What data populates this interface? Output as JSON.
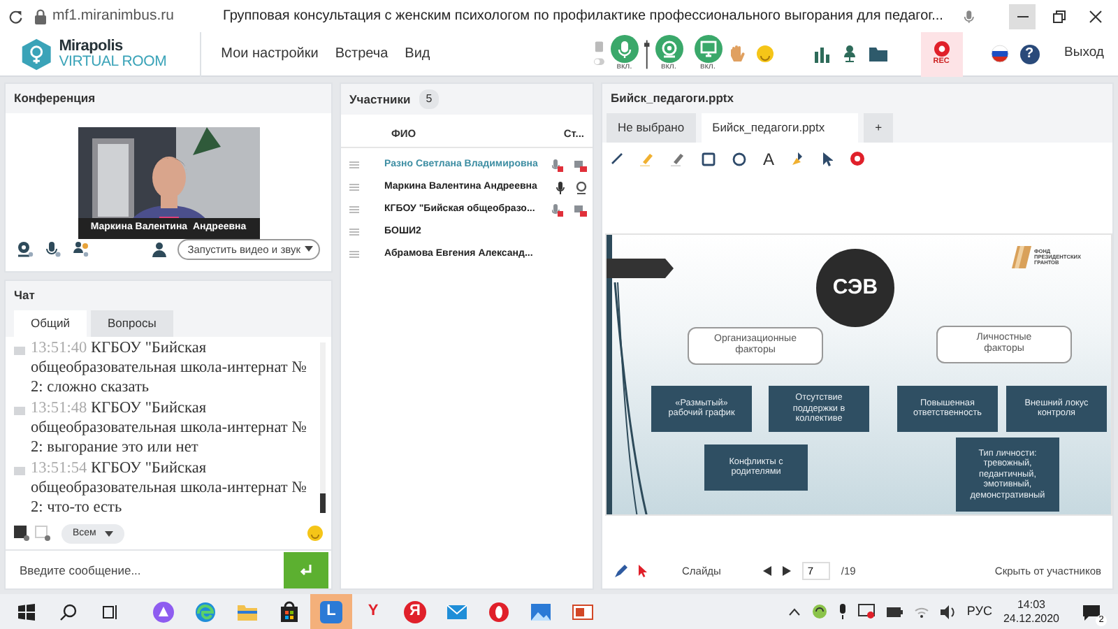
{
  "browser": {
    "url": "mf1.miranimbus.ru",
    "title": "Групповая консультация с женским психологом по профилактике профессионального выгорания для педагог..."
  },
  "app": {
    "logo_line1": "Mirapolis",
    "logo_line2": "VIRTUAL ROOM",
    "menu": [
      "Мои настройки",
      "Встреча",
      "Вид"
    ],
    "media_buttons": [
      {
        "kind": "microphone",
        "label": "вкл.",
        "on": true
      },
      {
        "kind": "camera",
        "label": "вкл.",
        "on": true
      },
      {
        "kind": "screen",
        "label": "вкл.",
        "on": true
      }
    ],
    "rec_label": "REC",
    "help_label": "?",
    "exit": "Выход"
  },
  "conference": {
    "title": "Конференция",
    "video_caption": "Маркина Валентина  Андреевна",
    "start_select": "Запустить видео и звук"
  },
  "chat": {
    "title": "Чат",
    "tabs": [
      {
        "label": "Общий",
        "selected": true
      },
      {
        "label": "Вопросы",
        "selected": false
      }
    ],
    "messages": [
      {
        "time": "13:51:40",
        "text": "КГБОУ \"Бийская общеобразовательная школа-интернат № 2: сложно сказать"
      },
      {
        "time": "13:51:48",
        "text": "КГБОУ \"Бийская общеобразовательная школа-интернат № 2: выгорание это или нет"
      },
      {
        "time": "13:51:54",
        "text": "КГБОУ \"Бийская общеобразовательная школа-интернат № 2: что-то есть"
      }
    ],
    "recipient": "Всем",
    "placeholder": "Введите сообщение..."
  },
  "participants": {
    "title": "Участники",
    "count": "5",
    "columns": [
      "ФИО",
      "Ст..."
    ],
    "rows": [
      {
        "name": "Разно Светлана  Владимировна",
        "self": true,
        "mic_muted": true,
        "camera_muted": true
      },
      {
        "name": "Маркина Валентина  Андреевна",
        "self": false,
        "mic_muted": false,
        "camera_muted": false
      },
      {
        "name": "КГБОУ \"Бийская общеобразо...",
        "self": false,
        "mic_muted": true,
        "camera_muted": true
      },
      {
        "name": "БОШИ2",
        "self": false
      },
      {
        "name": "Абрамова  Евгения  Александ...",
        "self": false
      }
    ]
  },
  "presentation": {
    "title": "Бийск_педагоги.pptx",
    "tabs": [
      {
        "label": "Не выбрано",
        "selected": false
      },
      {
        "label": "Бийск_педагоги.pptx",
        "selected": true
      },
      {
        "label": "+",
        "selected": false
      }
    ],
    "text_tool": "A",
    "slide": {
      "badge": "СЭВ",
      "logo_lines": [
        "ФОНД",
        "ПРЕЗИДЕНТСКИХ",
        "ГРАНТОВ"
      ],
      "nodes": [
        {
          "kind": "heading",
          "text": "Организационные факторы"
        },
        {
          "kind": "heading",
          "text": "Личностные факторы"
        },
        {
          "kind": "factor",
          "text": "«Размытый» рабочий график"
        },
        {
          "kind": "factor",
          "text": "Отсутствие поддержки в коллективе"
        },
        {
          "kind": "factor",
          "text": "Повышенная ответственность"
        },
        {
          "kind": "factor",
          "text": "Внешний локус контроля"
        },
        {
          "kind": "factor",
          "text": "Конфликты с родителями"
        },
        {
          "kind": "factor",
          "text": "Тип личности: тревожный, педантичный, эмотивный, демонстративный"
        }
      ]
    },
    "footer": {
      "slides_label": "Слайды",
      "page": "7",
      "total": "/19",
      "hide": "Скрыть от участников"
    }
  },
  "taskbar": {
    "apps": [
      {
        "kind": "alice",
        "active": false
      },
      {
        "kind": "edge",
        "active": false
      },
      {
        "kind": "explorer",
        "active": false
      },
      {
        "kind": "store",
        "active": false
      },
      {
        "kind": "letter",
        "label": "L",
        "active": true
      },
      {
        "kind": "browser",
        "label": "Y",
        "active": false
      },
      {
        "kind": "yandex",
        "label": "Я",
        "active": false
      },
      {
        "kind": "mail",
        "active": false
      },
      {
        "kind": "opera",
        "active": false
      },
      {
        "kind": "photos",
        "active": false
      },
      {
        "kind": "slides",
        "active": false
      }
    ],
    "lang": "РУС",
    "time": "14:03",
    "date": "24.12.2020",
    "notifications": "2"
  }
}
